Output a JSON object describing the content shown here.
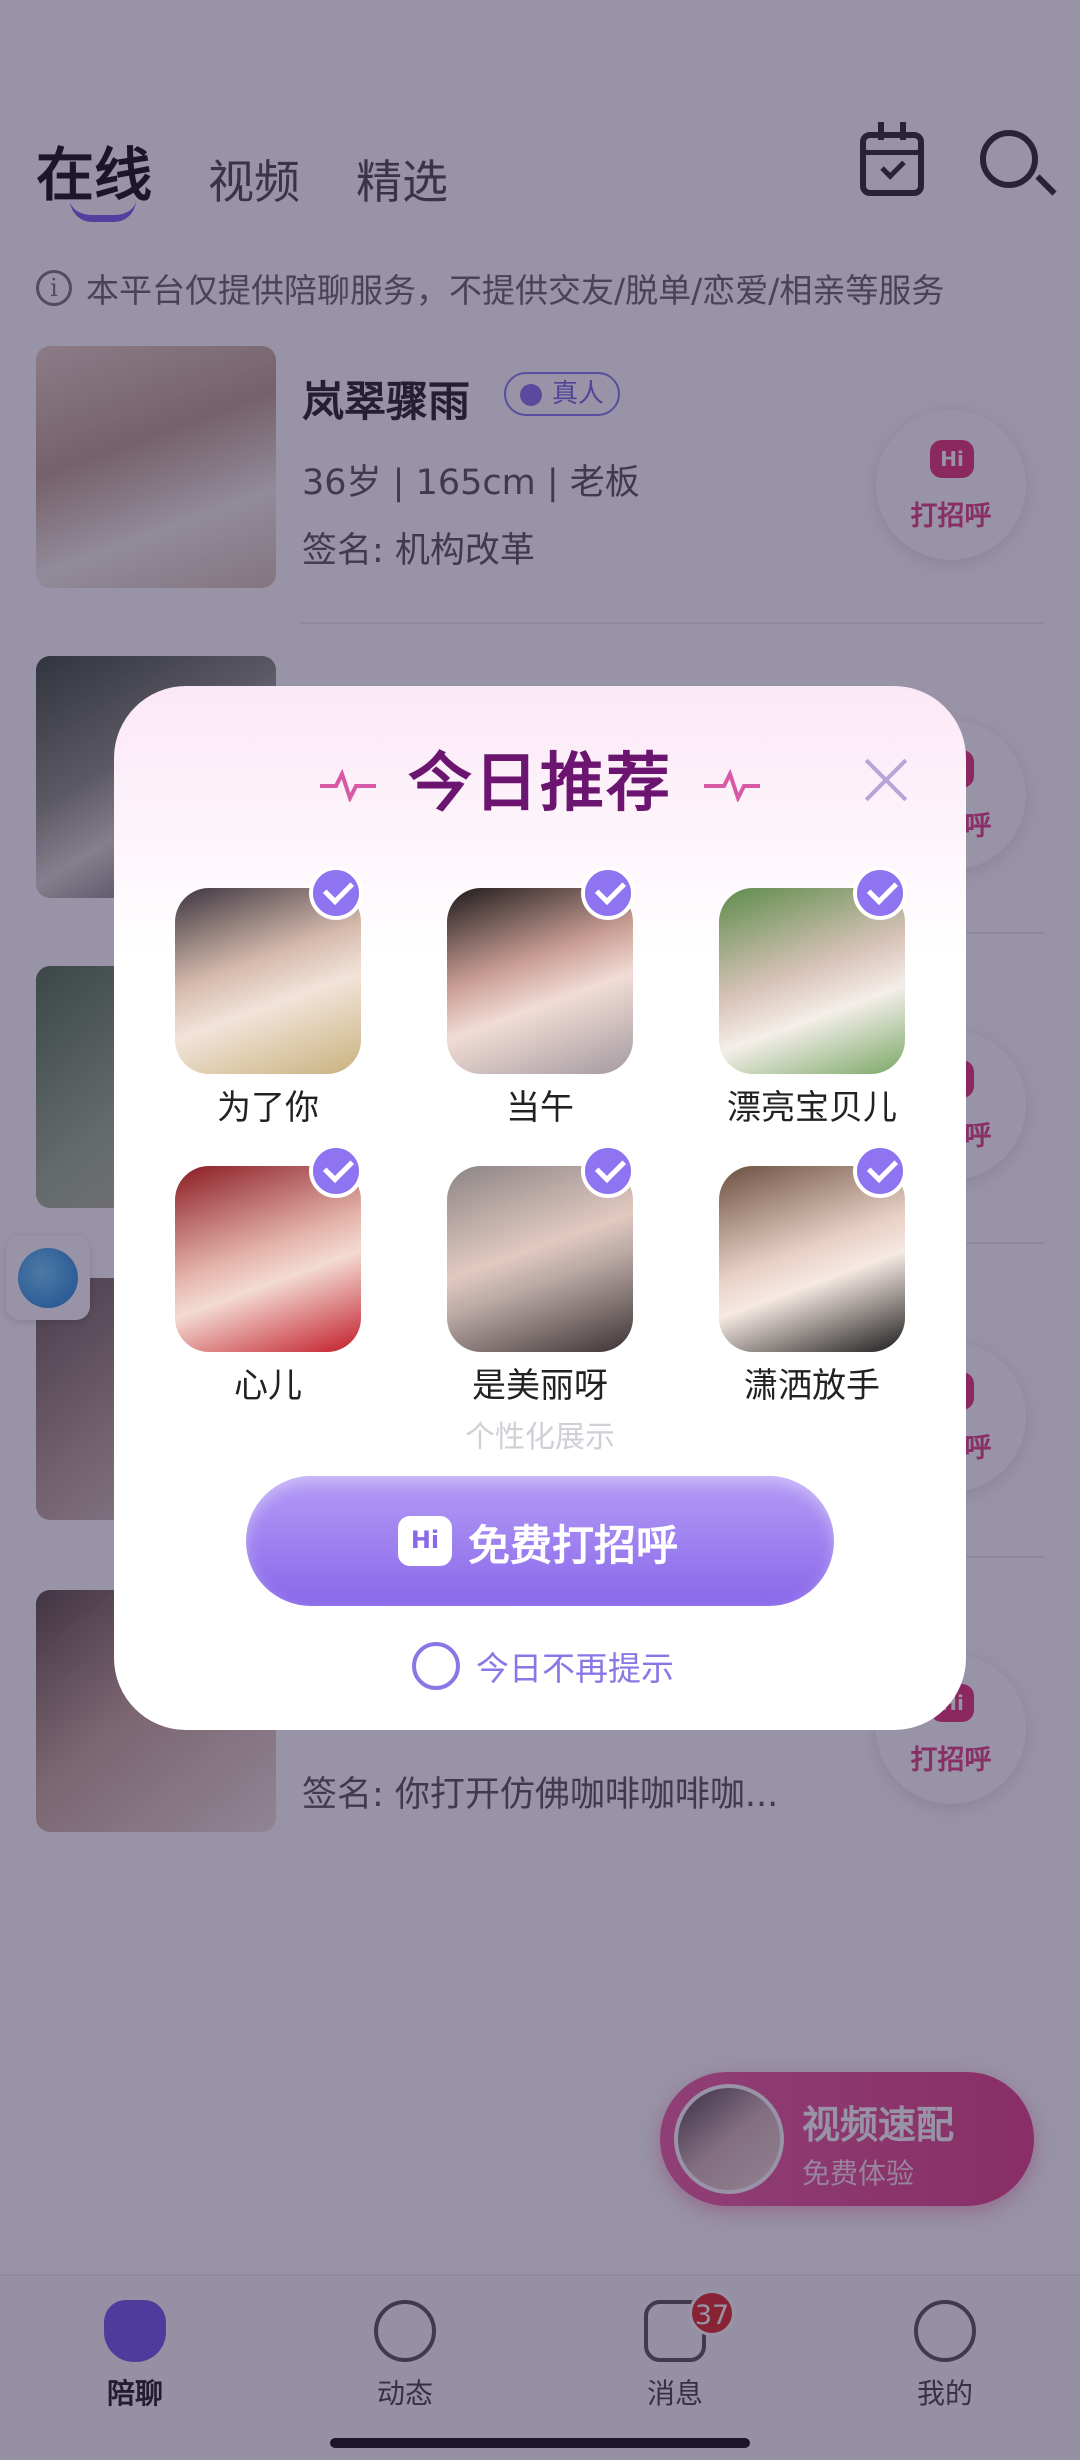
{
  "header": {
    "tabs": [
      {
        "label": "在线",
        "active": true
      },
      {
        "label": "视频",
        "active": false
      },
      {
        "label": "精选",
        "active": false
      }
    ],
    "icons": [
      "calendar-check-icon",
      "search-icon"
    ]
  },
  "notice": {
    "text": "本平台仅提供陪聊服务，不提供交友/脱单/恋爱/相亲等服务"
  },
  "list": [
    {
      "name": "岚翠骤雨",
      "badge": "真人",
      "meta": "36岁 | 165cm | 老板",
      "sign": "签名: 机构改革",
      "greet": "打招呼"
    },
    {
      "name": "",
      "badge": "",
      "meta": "",
      "sign": "",
      "greet": "打招呼"
    },
    {
      "name": "",
      "badge": "",
      "meta": "",
      "sign": "",
      "greet": "打招呼"
    },
    {
      "name": "",
      "badge": "",
      "meta": "",
      "sign": "",
      "greet": "打招呼"
    },
    {
      "name": "",
      "badge": "",
      "meta": "",
      "sign": "签名: 你打开仿佛咖啡咖啡咖...",
      "greet": "打招呼"
    }
  ],
  "greet_bubble": "Hi",
  "video_match": {
    "title": "视频速配",
    "subtitle": "免费体验"
  },
  "tabbar": [
    {
      "label": "陪聊",
      "icon": "heart-home-icon",
      "active": true
    },
    {
      "label": "动态",
      "icon": "planet-icon",
      "active": false
    },
    {
      "label": "消息",
      "icon": "message-icon",
      "badge": "37",
      "active": false
    },
    {
      "label": "我的",
      "icon": "profile-icon",
      "active": false
    }
  ],
  "modal": {
    "title": "今日推荐",
    "candidates": [
      {
        "name": "为了你",
        "checked": true
      },
      {
        "name": "当午",
        "checked": true
      },
      {
        "name": "漂亮宝贝儿",
        "checked": true
      },
      {
        "name": "心儿",
        "checked": true
      },
      {
        "name": "是美丽呀",
        "checked": true
      },
      {
        "name": "潇洒放手",
        "checked": true
      }
    ],
    "personal_note": "个性化展示",
    "button_icon_text": "Hi",
    "button_label": "免费打招呼",
    "no_remind": "今日不再提示"
  },
  "colors": {
    "accent": "#8a68ea",
    "brand_pink": "#e23e86",
    "title": "#6c1570"
  }
}
